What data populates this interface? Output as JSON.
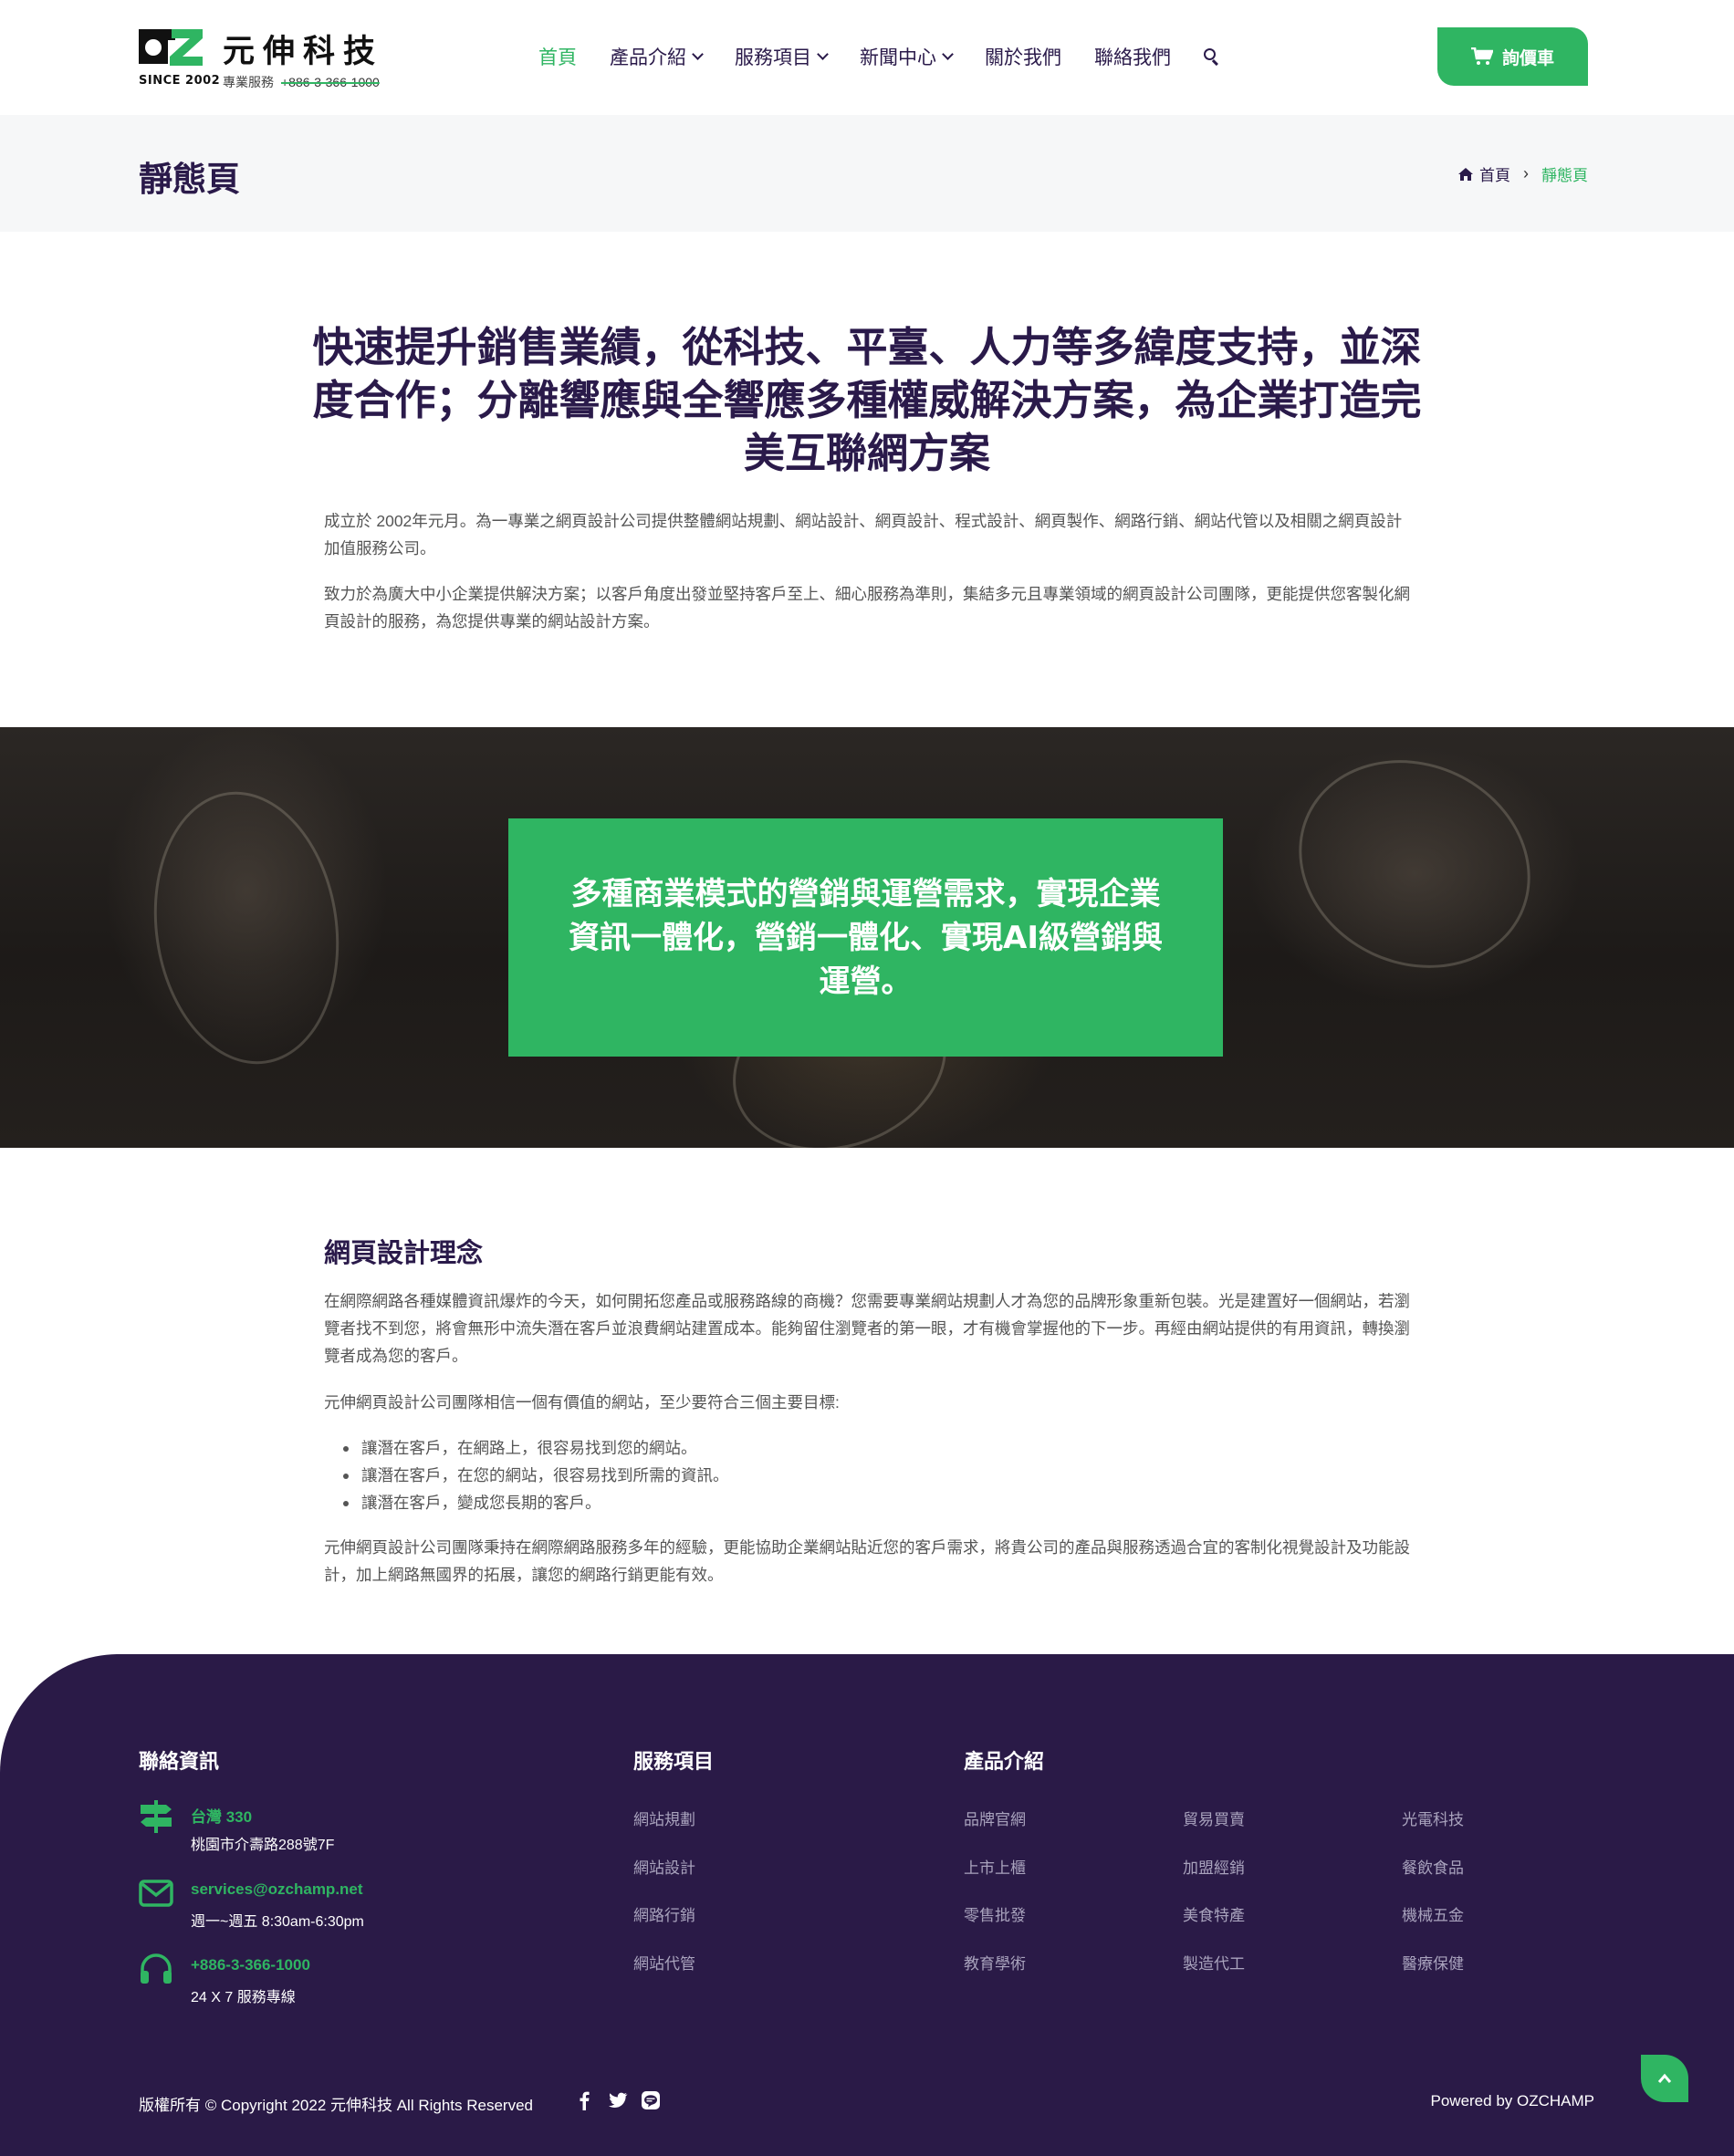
{
  "brand": {
    "name": "元伸科技",
    "since": "SINCE 2002",
    "service_label": "專業服務",
    "service_phone": "+886-3-366-1000",
    "accent_color": "#2fb562",
    "dark_color": "#2a1a4a"
  },
  "nav": {
    "items": [
      {
        "label": "首頁",
        "active": true,
        "dropdown": false
      },
      {
        "label": "產品介紹",
        "active": false,
        "dropdown": true
      },
      {
        "label": "服務項目",
        "active": false,
        "dropdown": true
      },
      {
        "label": "新聞中心",
        "active": false,
        "dropdown": true
      },
      {
        "label": "關於我們",
        "active": false,
        "dropdown": false
      },
      {
        "label": "聯絡我們",
        "active": false,
        "dropdown": false
      }
    ],
    "search_icon": "search-icon",
    "cart_label": "詢價車",
    "cart_icon": "shopping-cart-icon"
  },
  "page": {
    "title": "靜態頁",
    "breadcrumb": {
      "home": "首頁",
      "separator": "›",
      "current": "靜態頁"
    }
  },
  "intro": {
    "heading": "快速提升銷售業績，從科技、平臺、人力等多緯度支持，並深度合作；分離響應與全響應多種權威解決方案，為企業打造完美互聯網方案",
    "paragraph1": "成立於 2002年元月。為一專業之網頁設計公司提供整體網站規劃、網站設計、網頁設計、程式設計、網頁製作、網路行銷、網站代管以及相關之網頁設計加值服務公司。",
    "paragraph2": "致力於為廣大中小企業提供解決方案；以客戶角度出發並堅持客戶至上、細心服務為準則，集結多元且專業領域的網頁設計公司團隊，更能提供您客製化網頁設計的服務，為您提供專業的網站設計方案。"
  },
  "banner": {
    "text": "多種商業模式的營銷與運營需求，實現企業資訊一體化，營銷一體化、實現AI級營銷與運營。"
  },
  "philosophy": {
    "title": "網頁設計理念",
    "paragraph1": "在網際網路各種媒體資訊爆炸的今天，如何開拓您產品或服務路線的商機？您需要專業網站規劃人才為您的品牌形象重新包裝。光是建置好一個網站，若瀏覽者找不到您，將會無形中流失潛在客戶並浪費網站建置成本。能夠留住瀏覽者的第一眼，才有機會掌握他的下一步。再經由網站提供的有用資訊，轉換瀏覽者成為您的客戶。",
    "paragraph2": "元伸網頁設計公司團隊相信一個有價值的網站，至少要符合三個主要目標:",
    "list": [
      "讓潛在客戶，在網路上，很容易找到您的網站。",
      "讓潛在客戶，在您的網站，很容易找到所需的資訊。",
      "讓潛在客戶，變成您長期的客戶。"
    ],
    "paragraph3": "元伸網頁設計公司團隊秉持在網際網路服務多年的經驗，更能協助企業網站貼近您的客戶需求，將貴公司的產品與服務透過合宜的客制化視覺設計及功能設計，加上網路無國界的拓展，讓您的網路行銷更能有效。"
  },
  "footer": {
    "contact": {
      "heading": "聯絡資訊",
      "items": [
        {
          "icon": "signpost-icon",
          "line1": "台灣 330",
          "line2": "桃園市介壽路288號7F"
        },
        {
          "icon": "mail-icon",
          "line1": "services@ozchamp.net",
          "line2": "週一~週五 8:30am-6:30pm"
        },
        {
          "icon": "headset-icon",
          "line1": "+886-3-366-1000",
          "line2": "24 X 7 服務專線"
        }
      ]
    },
    "services": {
      "heading": "服務項目",
      "links": [
        "網站規劃",
        "網站設計",
        "網路行銷",
        "網站代管"
      ]
    },
    "products": {
      "heading": "產品介紹",
      "col1": [
        "品牌官網",
        "上市上櫃",
        "零售批發",
        "教育學術"
      ],
      "col2": [
        "貿易買賣",
        "加盟經銷",
        "美食特產",
        "製造代工"
      ],
      "col3": [
        "光電科技",
        "餐飲食品",
        "機械五金",
        "醫療保健"
      ]
    },
    "copyright": "版權所有 © Copyright 2022 元伸科技 All Rights Reserved",
    "social_icons": [
      "facebook-icon",
      "twitter-icon",
      "line-icon"
    ],
    "powered": "Powered by OZCHAMP",
    "background_color": "#2a1a47"
  }
}
